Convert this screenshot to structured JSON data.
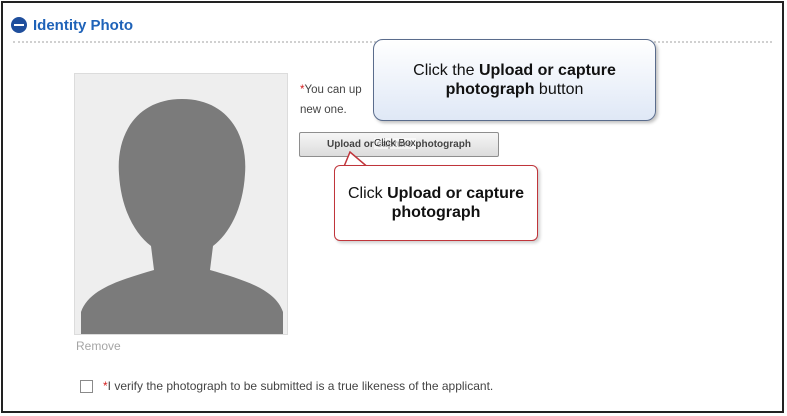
{
  "section": {
    "title": "Identity Photo",
    "toggle_icon": "collapse-circle-icon"
  },
  "photo": {
    "placeholder_icon": "person-silhouette-icon",
    "remove_label": "Remove"
  },
  "instruction": {
    "required_mark": "*",
    "line1": "You can up",
    "line2": "new one."
  },
  "upload_button": {
    "label": "Upload or capture photograph"
  },
  "click_box_label": "Click Box",
  "callout_top": {
    "prefix": "Click the ",
    "bold": "Upload or capture photograph",
    "suffix": " button"
  },
  "callout_bottom": {
    "prefix": "Click ",
    "bold": "Upload or capture photograph"
  },
  "verification": {
    "required_mark": "*",
    "label": "I verify the photograph to be submitted is a true likeness of the applicant.",
    "checked": false
  },
  "colors": {
    "accent": "#1e62b8",
    "required": "#d32020",
    "callout_border_red": "#c0353b",
    "callout_border_blue": "#5a6c8c"
  }
}
